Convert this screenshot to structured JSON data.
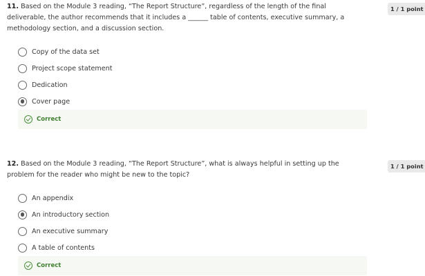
{
  "questions": [
    {
      "number": "11.",
      "text": "Based on the Module 3 reading, “The Report Structure”, regardless of the length of the final deliverable, the author recommends that it includes a ______ table of contents, executive summary, a methodology section, and a discussion section.",
      "points": "1 / 1 point",
      "options": [
        {
          "label": "Copy of the data set",
          "selected": false
        },
        {
          "label": "Project scope statement",
          "selected": false
        },
        {
          "label": "Dedication",
          "selected": false
        },
        {
          "label": "Cover page",
          "selected": true
        }
      ],
      "feedback": "Correct"
    },
    {
      "number": "12.",
      "text": "Based on the Module 3 reading, “The Report Structure”, what is always helpful in setting up the problem for the reader who might be new to the topic?",
      "points": "1 / 1 point",
      "options": [
        {
          "label": "An appendix",
          "selected": false
        },
        {
          "label": "An introductory section",
          "selected": true
        },
        {
          "label": "An executive summary",
          "selected": false
        },
        {
          "label": "A table of contents",
          "selected": false
        }
      ],
      "feedback": "Correct"
    }
  ]
}
